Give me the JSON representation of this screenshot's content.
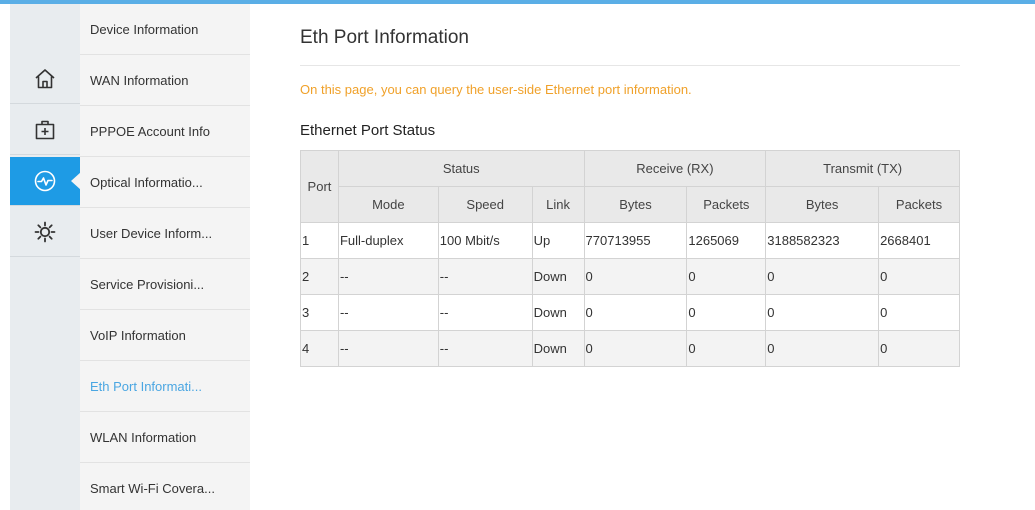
{
  "colors": {
    "accent": "#1e9be5",
    "active_text": "#4aa6e2",
    "notice": "#f0a12a"
  },
  "rail": {
    "icons": [
      {
        "name": "home-icon"
      },
      {
        "name": "first-aid-box-icon"
      },
      {
        "name": "heartbeat-monitor-icon",
        "active": true
      },
      {
        "name": "gear-icon"
      }
    ]
  },
  "submenu": {
    "items": [
      {
        "label": "Device Information"
      },
      {
        "label": "WAN Information"
      },
      {
        "label": "PPPOE Account Info"
      },
      {
        "label": "Optical Informatio..."
      },
      {
        "label": "User Device Inform..."
      },
      {
        "label": "Service Provisioni..."
      },
      {
        "label": "VoIP Information"
      },
      {
        "label": "Eth Port Informati...",
        "active": true
      },
      {
        "label": "WLAN Information"
      },
      {
        "label": "Smart Wi-Fi Covera..."
      }
    ]
  },
  "page": {
    "title": "Eth Port Information",
    "description": "On this page, you can query the user-side Ethernet port information.",
    "section_title": "Ethernet Port Status"
  },
  "table": {
    "group_headers": {
      "port": "Port",
      "status": "Status",
      "receive": "Receive (RX)",
      "transmit": "Transmit (TX)"
    },
    "sub_headers": {
      "mode": "Mode",
      "speed": "Speed",
      "link": "Link",
      "rx_bytes": "Bytes",
      "rx_packets": "Packets",
      "tx_bytes": "Bytes",
      "tx_packets": "Packets"
    },
    "rows": [
      {
        "port": "1",
        "mode": "Full-duplex",
        "speed": "100 Mbit/s",
        "link": "Up",
        "rx_bytes": "770713955",
        "rx_packets": "1265069",
        "tx_bytes": "3188582323",
        "tx_packets": "2668401"
      },
      {
        "port": "2",
        "mode": "--",
        "speed": "--",
        "link": "Down",
        "rx_bytes": "0",
        "rx_packets": "0",
        "tx_bytes": "0",
        "tx_packets": "0"
      },
      {
        "port": "3",
        "mode": "--",
        "speed": "--",
        "link": "Down",
        "rx_bytes": "0",
        "rx_packets": "0",
        "tx_bytes": "0",
        "tx_packets": "0"
      },
      {
        "port": "4",
        "mode": "--",
        "speed": "--",
        "link": "Down",
        "rx_bytes": "0",
        "rx_packets": "0",
        "tx_bytes": "0",
        "tx_packets": "0"
      }
    ]
  }
}
